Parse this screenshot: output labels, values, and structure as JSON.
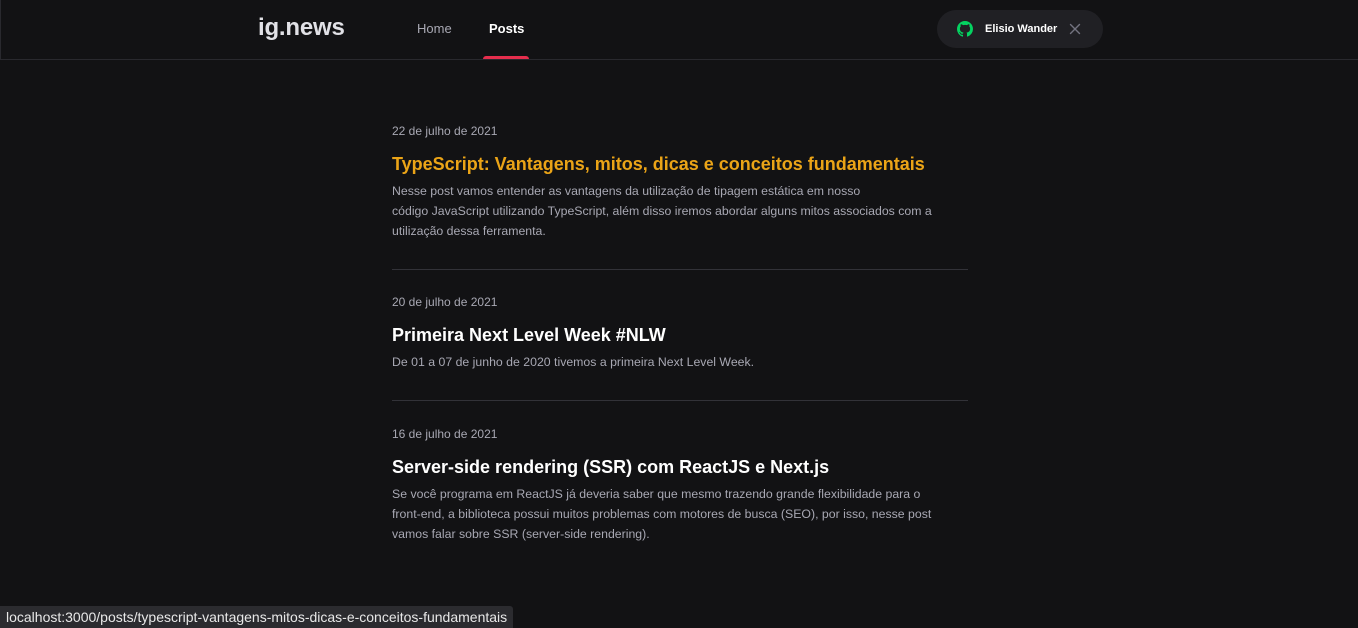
{
  "header": {
    "logo": "ig.news",
    "nav": {
      "home": "Home",
      "posts": "Posts"
    },
    "user": {
      "name": "Elisio Wander",
      "icon": "github-icon",
      "close_icon": "close-icon"
    },
    "colors": {
      "accent": "#e52e4d",
      "github_green": "#04d361",
      "highlight": "#eba417"
    }
  },
  "posts": [
    {
      "date": "22 de julho de 2021",
      "title": "TypeScript: Vantagens, mitos, dicas e conceitos fundamentais",
      "excerpt_lines": [
        "Nesse post vamos entender as vantagens da utilização de tipagem estática em nosso",
        "código JavaScript utilizando TypeScript, além disso iremos abordar alguns mitos associados com a",
        "utilização dessa ferramenta."
      ]
    },
    {
      "date": "20 de julho de 2021",
      "title": "Primeira Next Level Week #NLW",
      "excerpt_lines": [
        "De 01 a 07 de junho de 2020 tivemos a primeira Next Level Week."
      ]
    },
    {
      "date": "16 de julho de 2021",
      "title": "Server-side rendering (SSR) com ReactJS e Next.js",
      "excerpt_lines": [
        "Se você programa em ReactJS já deveria saber que mesmo trazendo grande flexibilidade para o",
        "front-end, a biblioteca possui muitos problemas com motores de busca (SEO), por isso, nesse post",
        "vamos falar sobre SSR (server-side rendering)."
      ]
    }
  ],
  "status_bar": {
    "url": "localhost:3000/posts/typescript-vantagens-mitos-dicas-e-conceitos-fundamentais"
  }
}
